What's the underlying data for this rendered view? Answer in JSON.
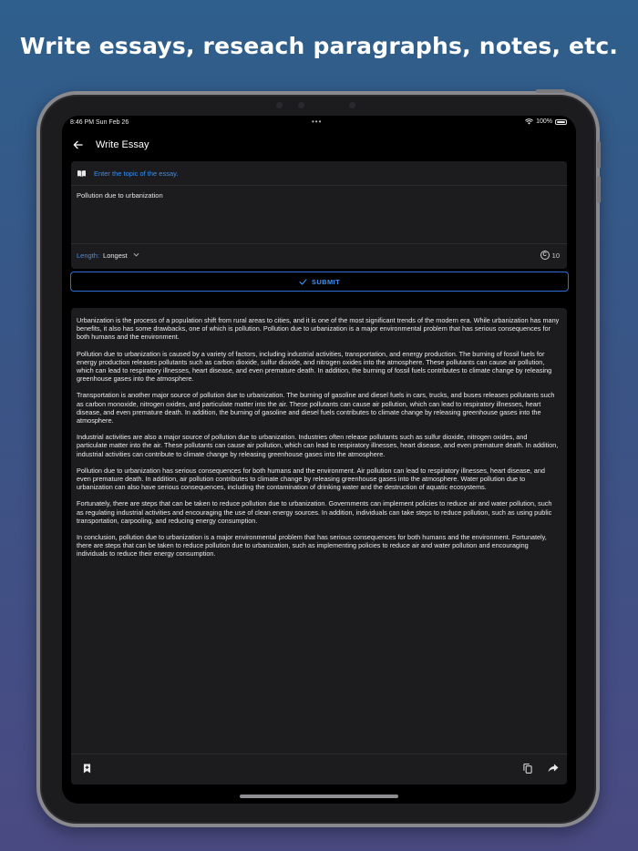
{
  "headline": "Write essays, reseach paragraphs, notes, etc.",
  "status": {
    "time": "8:46 PM   Sun Feb 26",
    "dots": "•••",
    "battery": "100%"
  },
  "nav": {
    "title": "Write Essay",
    "back_icon": "arrow-left-icon"
  },
  "form": {
    "topic_label": "Enter the topic of the essay.",
    "topic_value": "Pollution due to urbanization",
    "length_label": "Length:",
    "length_value": "Longest",
    "credits": "10",
    "credit_symbol": "C"
  },
  "submit_label": "SUBMIT",
  "essay": [
    "Urbanization is the process of a population shift from rural areas to cities, and it is one of the most significant trends of the modern era. While urbanization has many benefits, it also has some drawbacks, one of which is pollution. Pollution due to urbanization is a major environmental problem that has serious consequences for both humans and the environment.",
    "Pollution due to urbanization is caused by a variety of factors, including industrial activities, transportation, and energy production. The burning of fossil fuels for energy production releases pollutants such as carbon dioxide, sulfur dioxide, and nitrogen oxides into the atmosphere. These pollutants can cause air pollution, which can lead to respiratory illnesses, heart disease, and even premature death. In addition, the burning of fossil fuels contributes to climate change by releasing greenhouse gases into the atmosphere.",
    "Transportation is another major source of pollution due to urbanization. The burning of gasoline and diesel fuels in cars, trucks, and buses releases pollutants such as carbon monoxide, nitrogen oxides, and particulate matter into the air. These pollutants can cause air pollution, which can lead to respiratory illnesses, heart disease, and even premature death. In addition, the burning of gasoline and diesel fuels contributes to climate change by releasing greenhouse gases into the atmosphere.",
    "Industrial activities are also a major source of pollution due to urbanization. Industries often release pollutants such as sulfur dioxide, nitrogen oxides, and particulate matter into the air. These pollutants can cause air pollution, which can lead to respiratory illnesses, heart disease, and even premature death. In addition, industrial activities can contribute to climate change by releasing greenhouse gases into the atmosphere.",
    "Pollution due to urbanization has serious consequences for both humans and the environment. Air pollution can lead to respiratory illnesses, heart disease, and even premature death. In addition, air pollution contributes to climate change by releasing greenhouse gases into the atmosphere. Water pollution due to urbanization can also have serious consequences, including the contamination of drinking water and the destruction of aquatic ecosystems.",
    "Fortunately, there are steps that can be taken to reduce pollution due to urbanization. Governments can implement policies to reduce air and water pollution, such as regulating industrial activities and encouraging the use of clean energy sources. In addition, individuals can take steps to reduce pollution, such as using public transportation, carpooling, and reducing energy consumption.",
    "In conclusion, pollution due to urbanization is a major environmental problem that has serious consequences for both humans and the environment. Fortunately, there are steps that can be taken to reduce pollution due to urbanization, such as implementing policies to reduce air and water pollution and encouraging individuals to reduce their energy consumption."
  ],
  "colors": {
    "accent": "#3b8ff0",
    "card": "#1c1c1e",
    "screen": "#000000"
  },
  "icons": [
    "bookmark-add-icon",
    "copy-icon",
    "share-icon",
    "book-icon",
    "check-icon",
    "wifi-icon",
    "battery-icon"
  ]
}
